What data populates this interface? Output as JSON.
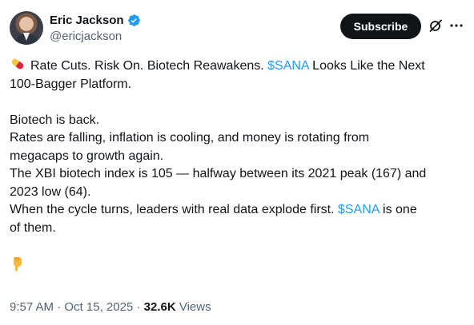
{
  "author": {
    "name": "Eric Jackson",
    "handle": "@ericjackson",
    "verified": true
  },
  "header": {
    "subscribe_label": "Subscribe",
    "icons": [
      "grok-icon",
      "more-icon"
    ]
  },
  "tweet": {
    "emoji_pill": "pill",
    "headline_part1": "Rate Cuts. Risk On. Biotech Reawakens. ",
    "headline_ticker": "$SANA",
    "headline_part2": " Looks Like the Next",
    "headline_line2": "100-Bagger Platform.",
    "p1": "Biotech is back.",
    "p2_line1": "Rates are falling, inflation is cooling, and money is rotating from",
    "p2_line2": "megacaps to growth again.",
    "p3_line1": "The XBI biotech index is 105 — halfway between its 2021 peak (167) and",
    "p3_line2": "2023 low (64).",
    "p4_part1": "When the cycle turns, leaders with real data explode first. ",
    "p4_ticker": "$SANA",
    "p4_part2": " is one",
    "p4_line2": "of them.",
    "emoji_point": "backhand-index-pointing-down"
  },
  "meta": {
    "time": "9:57 AM",
    "date": "Oct 15, 2025",
    "separator": " · ",
    "views_count": "32.6K",
    "views_label": " Views"
  },
  "colors": {
    "link": "#1d9bf0",
    "text": "#0f1419",
    "secondary": "#536471",
    "button_bg": "#0f1419"
  }
}
